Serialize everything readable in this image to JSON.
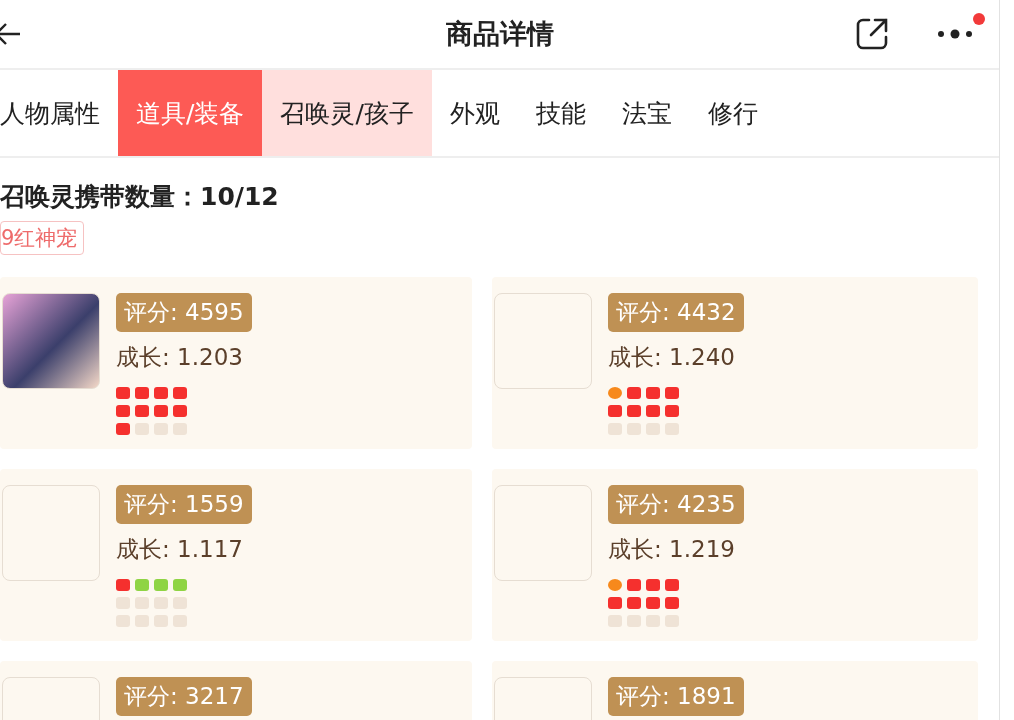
{
  "header": {
    "title": "商品详情",
    "more_badge": true
  },
  "tabs": [
    {
      "label": "人物属性",
      "selected": false,
      "hovered": false
    },
    {
      "label": "道具/装备",
      "selected": true,
      "hovered": false
    },
    {
      "label": "召唤灵/孩子",
      "selected": false,
      "hovered": true
    },
    {
      "label": "外观",
      "selected": false,
      "hovered": false
    },
    {
      "label": "技能",
      "selected": false,
      "hovered": false
    },
    {
      "label": "法宝",
      "selected": false,
      "hovered": false
    },
    {
      "label": "修行",
      "selected": false,
      "hovered": false
    }
  ],
  "summary": {
    "count_label": "召唤灵携带数量：10/12",
    "tags": [
      "9红神宠"
    ]
  },
  "pets": [
    {
      "has_portrait": true,
      "score": "评分: 4595",
      "growth": "成长: 1.203",
      "dots": [
        {
          "kind": "square",
          "color": "#f5302e"
        },
        {
          "kind": "square",
          "color": "#f5302e"
        },
        {
          "kind": "square",
          "color": "#f5302e"
        },
        {
          "kind": "square",
          "color": "#f5302e"
        },
        {
          "kind": "square",
          "color": "#f5302e"
        },
        {
          "kind": "square",
          "color": "#f5302e"
        },
        {
          "kind": "square",
          "color": "#f5302e"
        },
        {
          "kind": "square",
          "color": "#f5302e"
        },
        {
          "kind": "square",
          "color": "#f5302e"
        },
        {
          "kind": "square",
          "color": "#efe3d6"
        },
        {
          "kind": "square",
          "color": "#efe3d6"
        },
        {
          "kind": "square",
          "color": "#efe3d6"
        }
      ]
    },
    {
      "has_portrait": false,
      "score": "评分: 4432",
      "growth": "成长: 1.240",
      "dots": [
        {
          "kind": "round",
          "color": "#f7891c"
        },
        {
          "kind": "square",
          "color": "#f5302e"
        },
        {
          "kind": "square",
          "color": "#f5302e"
        },
        {
          "kind": "square",
          "color": "#f5302e"
        },
        {
          "kind": "square",
          "color": "#f5302e"
        },
        {
          "kind": "square",
          "color": "#f5302e"
        },
        {
          "kind": "square",
          "color": "#f5302e"
        },
        {
          "kind": "square",
          "color": "#f5302e"
        },
        {
          "kind": "square",
          "color": "#efe3d6"
        },
        {
          "kind": "square",
          "color": "#efe3d6"
        },
        {
          "kind": "square",
          "color": "#efe3d6"
        },
        {
          "kind": "square",
          "color": "#efe3d6"
        }
      ]
    },
    {
      "has_portrait": false,
      "score": "评分: 1559",
      "growth": "成长: 1.117",
      "dots": [
        {
          "kind": "square",
          "color": "#f5302e"
        },
        {
          "kind": "square",
          "color": "#8fd444"
        },
        {
          "kind": "square",
          "color": "#8fd444"
        },
        {
          "kind": "square",
          "color": "#8fd444"
        },
        {
          "kind": "square",
          "color": "#efe3d6"
        },
        {
          "kind": "square",
          "color": "#efe3d6"
        },
        {
          "kind": "square",
          "color": "#efe3d6"
        },
        {
          "kind": "square",
          "color": "#efe3d6"
        },
        {
          "kind": "square",
          "color": "#efe3d6"
        },
        {
          "kind": "square",
          "color": "#efe3d6"
        },
        {
          "kind": "square",
          "color": "#efe3d6"
        },
        {
          "kind": "square",
          "color": "#efe3d6"
        }
      ]
    },
    {
      "has_portrait": false,
      "score": "评分: 4235",
      "growth": "成长: 1.219",
      "dots": [
        {
          "kind": "round",
          "color": "#f7891c"
        },
        {
          "kind": "square",
          "color": "#f5302e"
        },
        {
          "kind": "square",
          "color": "#f5302e"
        },
        {
          "kind": "square",
          "color": "#f5302e"
        },
        {
          "kind": "square",
          "color": "#f5302e"
        },
        {
          "kind": "square",
          "color": "#f5302e"
        },
        {
          "kind": "square",
          "color": "#f5302e"
        },
        {
          "kind": "square",
          "color": "#f5302e"
        },
        {
          "kind": "square",
          "color": "#efe3d6"
        },
        {
          "kind": "square",
          "color": "#efe3d6"
        },
        {
          "kind": "square",
          "color": "#efe3d6"
        },
        {
          "kind": "square",
          "color": "#efe3d6"
        }
      ]
    },
    {
      "has_portrait": false,
      "score": "评分: 3217"
    },
    {
      "has_portrait": false,
      "score": "评分: 1891"
    }
  ]
}
